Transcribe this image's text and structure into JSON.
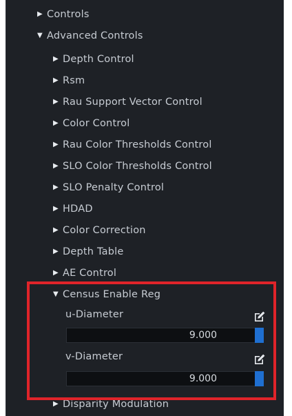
{
  "tree": {
    "controls": {
      "label": "Controls",
      "expanded": false
    },
    "advanced_controls": {
      "label": "Advanced Controls",
      "expanded": true,
      "children": [
        {
          "label": "Depth Control",
          "expanded": false
        },
        {
          "label": "Rsm",
          "expanded": false
        },
        {
          "label": "Rau Support Vector Control",
          "expanded": false
        },
        {
          "label": "Color Control",
          "expanded": false
        },
        {
          "label": "Rau Color Thresholds Control",
          "expanded": false
        },
        {
          "label": "SLO Color Thresholds Control",
          "expanded": false
        },
        {
          "label": "SLO Penalty Control",
          "expanded": false
        },
        {
          "label": "HDAD",
          "expanded": false
        },
        {
          "label": "Color Correction",
          "expanded": false
        },
        {
          "label": "Depth Table",
          "expanded": false
        },
        {
          "label": "AE Control",
          "expanded": false
        }
      ]
    },
    "census_enable_reg": {
      "label": "Census Enable Reg",
      "expanded": true,
      "properties": [
        {
          "label": "u-Diameter",
          "value": "9.000",
          "edit_icon": "edit-icon"
        },
        {
          "label": "v-Diameter",
          "value": "9.000",
          "edit_icon": "edit-icon"
        }
      ]
    },
    "disparity_modulation": {
      "label": "Disparity Modulation",
      "expanded": false
    }
  },
  "icons": {
    "collapsed_arrow": "▶",
    "expanded_arrow": "▼"
  },
  "colors": {
    "panel_background": "#1e2126",
    "text": "#c7ccd3",
    "value_field": "#0d0f12",
    "slider_accent": "#1f6fd1",
    "highlight": "#e0242a"
  }
}
